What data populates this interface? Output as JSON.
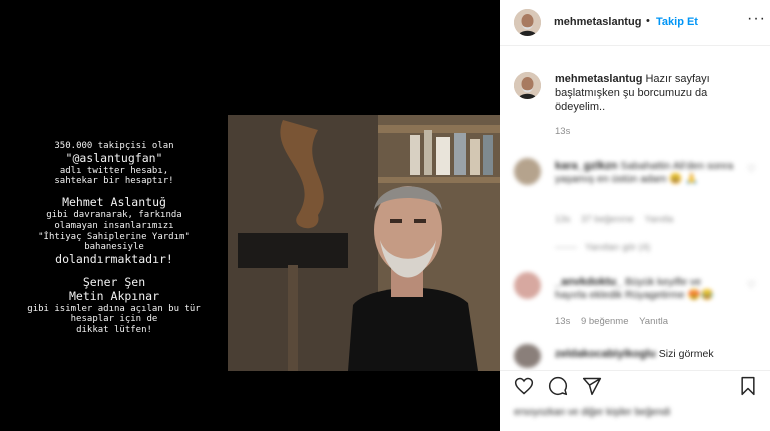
{
  "media": {
    "lines": [
      {
        "text": "350.000 takipçisi olan",
        "size": "sm"
      },
      {
        "text": "\"@aslantugfan\"",
        "size": "lg"
      },
      {
        "text": "adlı twitter hesabı,",
        "size": "sm"
      },
      {
        "text": "sahtekar bir hesaptır!",
        "size": "sm"
      },
      {
        "text": "",
        "size": "gap"
      },
      {
        "text": "Mehmet Aslantuğ",
        "size": "lg"
      },
      {
        "text": "gibi davranarak, farkında",
        "size": "sm"
      },
      {
        "text": "olamayan insanlarımızı",
        "size": "sm"
      },
      {
        "text": "\"İhtiyaç Sahiplerine Yardım\"",
        "size": "sm"
      },
      {
        "text": "bahanesiyle",
        "size": "sm"
      },
      {
        "text": "dolandırmaktadır!",
        "size": "lg"
      },
      {
        "text": "",
        "size": "gap"
      },
      {
        "text": "Şener Şen",
        "size": "lg"
      },
      {
        "text": "Metin Akpınar",
        "size": "lg"
      },
      {
        "text": "gibi isimler adına açılan bu tür",
        "size": "sm"
      },
      {
        "text": "hesaplar için de",
        "size": "sm"
      },
      {
        "text": "dikkat lütfen!",
        "size": "sm"
      }
    ]
  },
  "header": {
    "username": "mehmetaslantug",
    "separator": "•",
    "follow_label": "Takip Et",
    "more_icon": "more-horizontal-icon"
  },
  "caption": {
    "username": "mehmetaslantug",
    "text": "Hazır sayfayı başlatmışken şu borcumuzu da ödeyelim..",
    "time": "13s"
  },
  "comments": [
    {
      "username": "kara_gzlkzn",
      "text": "Sabahattin Ali'den sonra yaşamış en üstün adam 😃 🙏",
      "time": "13s",
      "likes": "37 beğenme",
      "reply": "Yanıtla",
      "view_replies": "Yanıtları gör (4)"
    },
    {
      "username": "_anvkdoktu_",
      "text": "Büyük keyifle ve hayırla ekledik Rüyagetirme 😍😂",
      "time": "13s",
      "likes": "9 beğenme",
      "reply": "Yanıtla"
    },
    {
      "username": "zeldakocabiyikoglu",
      "text": "Sizi görmek"
    }
  ],
  "actions": {
    "like_icon": "heart-icon",
    "comment_icon": "comment-icon",
    "share_icon": "send-icon",
    "save_icon": "bookmark-icon"
  },
  "likes_line": "ersoyozkan ve diğer kişiler beğendi",
  "colors": {
    "follow": "#0095f6",
    "text": "#262626",
    "meta": "#8e8e8e",
    "background": "#000000"
  }
}
